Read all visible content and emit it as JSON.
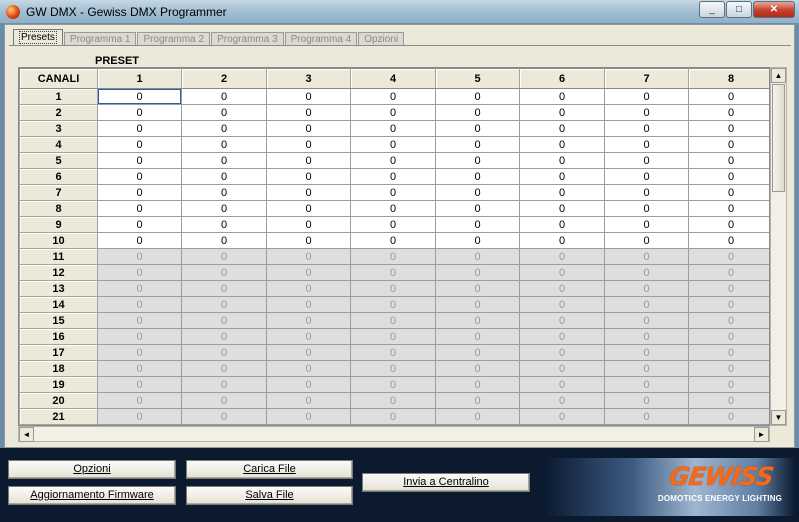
{
  "window": {
    "title": "GW DMX - Gewiss DMX Programmer",
    "minimize": "_",
    "maximize": "□",
    "close": "✕"
  },
  "tabs": [
    "Presets",
    "Programma 1",
    "Programma 2",
    "Programma 3",
    "Programma 4",
    "Opzioni"
  ],
  "active_tab": "Presets",
  "grid": {
    "group_label": "PRESET",
    "corner_header": "CANALI",
    "columns": [
      "1",
      "2",
      "3",
      "4",
      "5",
      "6",
      "7",
      "8"
    ],
    "rows": [
      "1",
      "2",
      "3",
      "4",
      "5",
      "6",
      "7",
      "8",
      "9",
      "10",
      "11",
      "12",
      "13",
      "14",
      "15",
      "16",
      "17",
      "18",
      "19",
      "20",
      "21"
    ],
    "cell_value": "0",
    "enabled_rows": 10
  },
  "scrollbars": {
    "up": "▲",
    "down": "▼",
    "left": "◄",
    "right": "►"
  },
  "buttons": {
    "opzioni": "Opzioni",
    "aggiornamento": "Aggiornamento Firmware",
    "carica": "Carica File",
    "salva": "Salva File",
    "invia": "Invia a Centralino"
  },
  "logo": {
    "brand": "GEWISS",
    "tagline": "DOMOTICS ENERGY LIGHTING"
  },
  "colors": {
    "brand_orange": "#f26a1b",
    "disabled_cell": "#dedede"
  }
}
